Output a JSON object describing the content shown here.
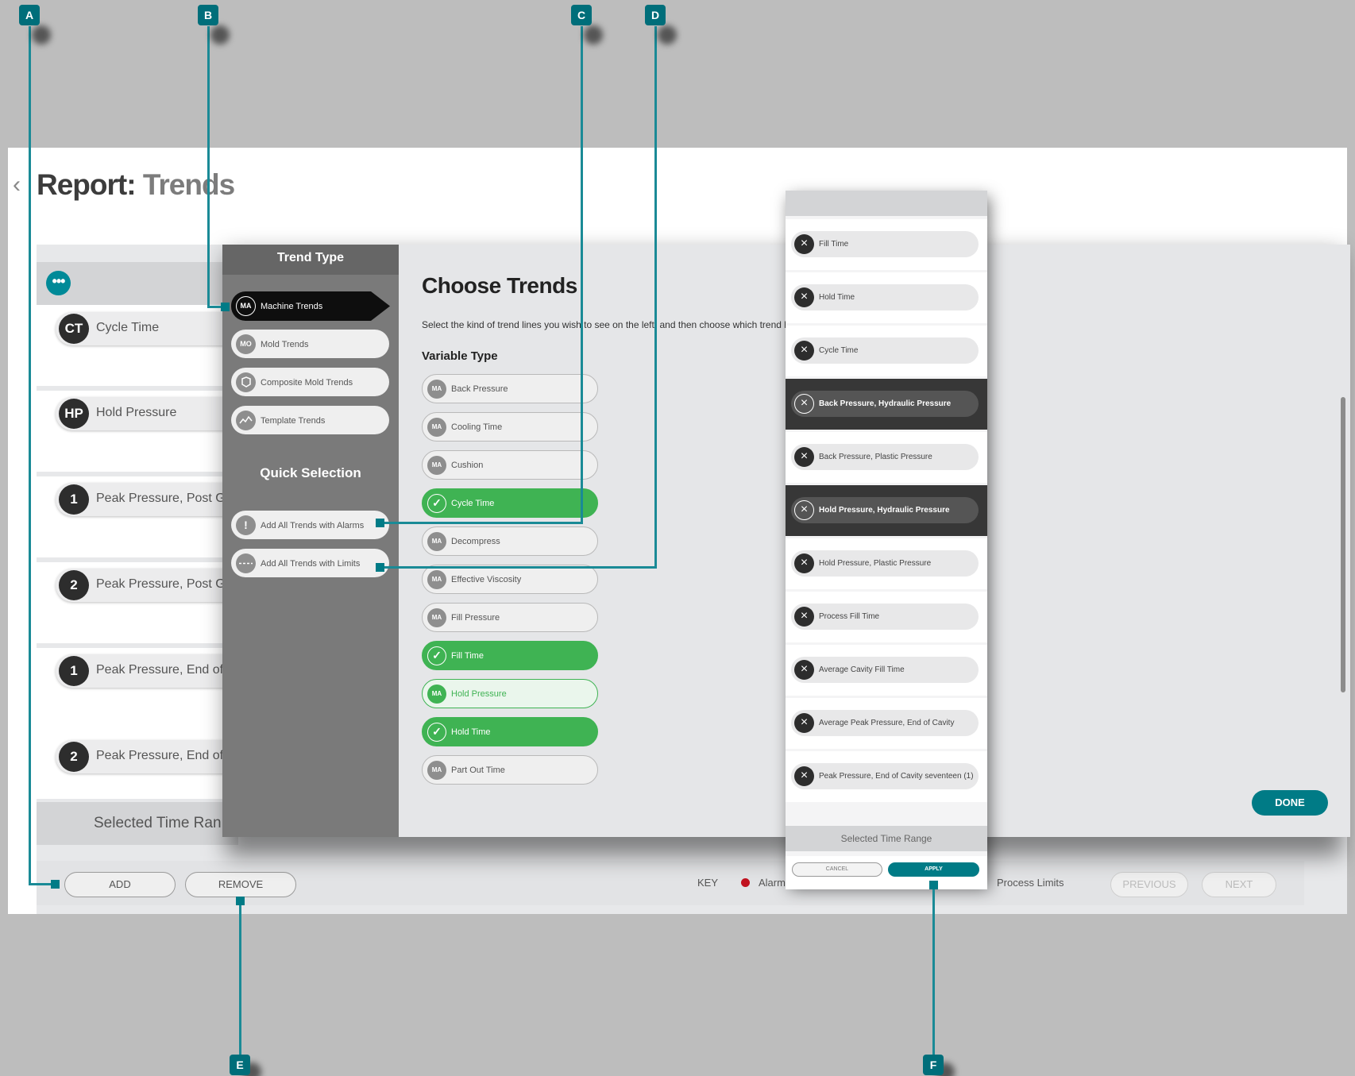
{
  "report": {
    "title_prefix": "Report:",
    "title_suffix": "Trends",
    "back_icon": "chevron-left-icon"
  },
  "background_list": {
    "more_icon": "more-horizontal-icon",
    "rows": [
      {
        "badge": "CT",
        "label": "Cycle Time"
      },
      {
        "badge": "HP",
        "label": "Hold Pressure"
      },
      {
        "badge": "1",
        "label": "Peak Pressure, Post Ga"
      },
      {
        "badge": "2",
        "label": "Peak Pressure, Post Ga"
      },
      {
        "badge": "1",
        "label": "Peak Pressure, End of C"
      },
      {
        "badge": "2",
        "label": "Peak Pressure, End of C"
      }
    ],
    "time_range_label": "Selected Time Ran"
  },
  "bottom_bar": {
    "add_label": "ADD",
    "remove_label": "REMOVE",
    "key_label": "KEY",
    "alarm_label": "Alarm",
    "limits_label": "Process Limits",
    "previous_label": "PREVIOUS",
    "next_label": "NEXT",
    "alarm_color": "#c1121f"
  },
  "trend_type": {
    "title": "Trend Type",
    "items": [
      {
        "icon": "MA",
        "label": "Machine Trends",
        "active": true
      },
      {
        "icon": "MO",
        "label": "Mold Trends",
        "active": false
      },
      {
        "icon": "composite-mold-icon",
        "label": "Composite Mold Trends",
        "active": false
      },
      {
        "icon": "template-trend-icon",
        "label": "Template Trends",
        "active": false
      }
    ],
    "quick_title": "Quick Selection",
    "quick_items": [
      {
        "icon": "alarm-exclamation-icon",
        "label": "Add All Trends with Alarms"
      },
      {
        "icon": "limits-dashed-icon",
        "label": "Add All Trends with Limits"
      }
    ]
  },
  "choose": {
    "title": "Choose Trends",
    "description": "Select the kind of trend lines you wish to see on the left, and then choose which trend lir",
    "variable_type_title": "Variable Type",
    "variables": [
      {
        "icon": "MA",
        "label": "Back Pressure",
        "state": "off"
      },
      {
        "icon": "MA",
        "label": "Cooling Time",
        "state": "off"
      },
      {
        "icon": "MA",
        "label": "Cushion",
        "state": "off"
      },
      {
        "icon": "check-icon",
        "label": "Cycle Time",
        "state": "on"
      },
      {
        "icon": "MA",
        "label": "Decompress",
        "state": "off"
      },
      {
        "icon": "MA",
        "label": "Effective Viscosity",
        "state": "off"
      },
      {
        "icon": "MA",
        "label": "Fill Pressure",
        "state": "off"
      },
      {
        "icon": "check-icon",
        "label": "Fill Time",
        "state": "on"
      },
      {
        "icon": "MA",
        "label": "Hold Pressure",
        "state": "partial"
      },
      {
        "icon": "check-icon",
        "label": "Hold Time",
        "state": "on"
      },
      {
        "icon": "MA",
        "label": "Part Out Time",
        "state": "off"
      }
    ],
    "on_color": "#3fb353"
  },
  "selected": {
    "items": [
      {
        "label": "Fill Time",
        "dark": false
      },
      {
        "label": "Hold Time",
        "dark": false
      },
      {
        "label": "Cycle Time",
        "dark": false
      },
      {
        "label": "Back Pressure, Hydraulic Pressure",
        "dark": true
      },
      {
        "label": "Back Pressure, Plastic Pressure",
        "dark": false
      },
      {
        "label": "Hold Pressure, Hydraulic Pressure",
        "dark": true
      },
      {
        "label": "Hold Pressure, Plastic Pressure",
        "dark": false
      },
      {
        "label": "Process Fill Time",
        "dark": false
      },
      {
        "label": "Average Cavity Fill Time",
        "dark": false
      },
      {
        "label": "Average Peak Pressure, End of Cavity",
        "dark": false
      },
      {
        "label": "Peak Pressure, End of Cavity seventeen (1)",
        "dark": false
      }
    ],
    "time_range_label": "Selected Time Range",
    "cancel_label": "CANCEL",
    "apply_label": "APPLY",
    "remove_icon": "close-icon"
  },
  "done_label": "DONE",
  "callouts": [
    "A",
    "B",
    "C",
    "D",
    "E",
    "F"
  ],
  "accent_color": "#007b86"
}
